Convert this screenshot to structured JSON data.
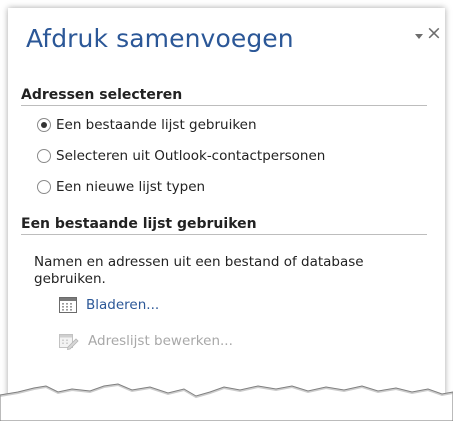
{
  "pane": {
    "title": "Afdruk samenvoegen",
    "pin_icon": "chevron-down-icon",
    "close_icon": "close-icon",
    "close_glyph": "×"
  },
  "select_section": {
    "heading": "Adressen selecteren",
    "options": [
      {
        "label": "Een bestaande lijst gebruiken",
        "checked": true
      },
      {
        "label": "Selecteren uit Outlook-contactpersonen",
        "checked": false
      },
      {
        "label": "Een nieuwe lijst typen",
        "checked": false
      }
    ]
  },
  "existing_section": {
    "heading": "Een bestaande lijst gebruiken",
    "description": "Namen en adressen uit een bestand of database gebruiken.",
    "browse_label": "Bladeren...",
    "browse_icon": "table-icon",
    "edit_label": "Adreslijst bewerken...",
    "edit_icon": "edit-list-icon",
    "edit_enabled": false
  },
  "colors": {
    "accent": "#2b5797",
    "disabled_text": "#a8a8a8"
  }
}
